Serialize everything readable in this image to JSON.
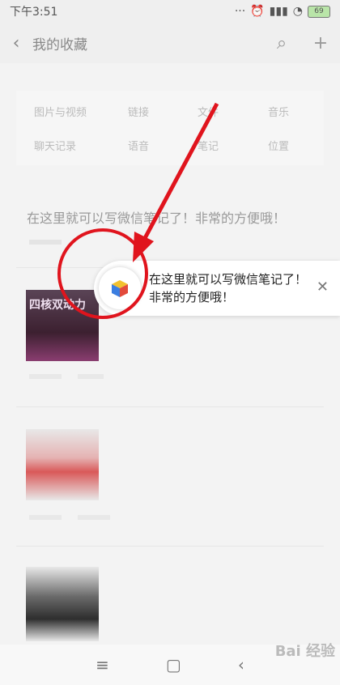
{
  "status": {
    "time": "下午3:51",
    "battery": "69"
  },
  "header": {
    "title": "我的收藏"
  },
  "categories": [
    "图片与视频",
    "链接",
    "文件",
    "音乐",
    "聊天记录",
    "语音",
    "笔记",
    "位置"
  ],
  "note_text": "在这里就可以写微信笔记了！非常的方便哦！",
  "thumb_a_text": "四核双动力",
  "tip": {
    "text": "在这里就可以写微信笔记了！非常的方便哦！"
  },
  "colors": {
    "annotation": "#e0141d",
    "tip_icon": [
      "#3b7ee0",
      "#f2c12e",
      "#e24a3b"
    ]
  },
  "watermark": "Bai 经验"
}
